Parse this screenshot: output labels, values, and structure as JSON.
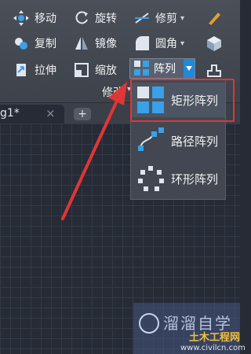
{
  "ribbon": {
    "row1": {
      "move": "移动",
      "rotate": "旋转",
      "trim": "修剪"
    },
    "row2": {
      "copy": "复制",
      "mirror": "镜像",
      "fillet": "圆角"
    },
    "row3": {
      "stretch": "拉伸",
      "scale": "缩放",
      "array": "阵列"
    },
    "panel_label": "修改"
  },
  "tabs": {
    "drawing_tab": "g1*",
    "close": "×",
    "new": "+"
  },
  "array_menu": {
    "items": [
      {
        "label": "矩形阵列",
        "icon": "rect-array-icon",
        "highlighted": true
      },
      {
        "label": "路径阵列",
        "icon": "path-array-icon"
      },
      {
        "label": "环形阵列",
        "icon": "polar-array-icon"
      }
    ]
  },
  "watermark": {
    "logo_text": "溜溜自学",
    "site_name": "土木工程网",
    "site_url": "www.civilcn.com"
  },
  "colors": {
    "highlight_border": "#e03636",
    "arrow": "#e03636",
    "dropdown_accent": "#1f8ad6"
  }
}
